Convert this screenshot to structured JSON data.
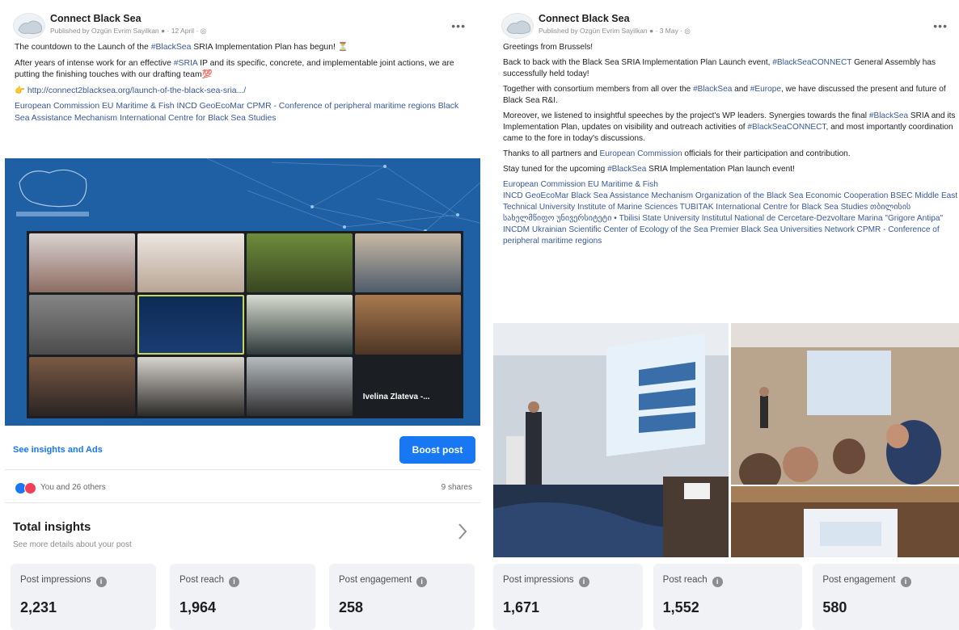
{
  "left_post": {
    "page_name": "Connect Black Sea",
    "byline": "Published by Ozgün Evrim Sayilkan ● · 12 April · ◎",
    "text": {
      "p1_a": "The countdown to the Launch of the ",
      "p1_tag": "#BlackSea",
      "p1_b": " SRIA Implementation Plan has begun! ⏳",
      "p2_a": "After years of intense work for an effective ",
      "p2_tag": "#SRIA",
      "p2_b": " IP and its specific, concrete, and implementable joint actions, we are putting the finishing touches with our drafting team💯",
      "link": "👉 http://connect2blacksea.org/launch-of-the-black-sea-sria.../",
      "tags": "European Commission  EU Maritime & Fish INCD GeoEcoMar CPMR - Conference of peripheral maritime regions Black Sea Assistance Mechanism International Centre for Black Sea Studies"
    },
    "zoom_name": "Ivelina Zlateva -...",
    "see_insights": "See insights and Ads",
    "boost_label": "Boost post",
    "reactions_text": "You and 26 others",
    "shares_text": "9 shares",
    "total_insights_title": "Total insights",
    "total_insights_sub": "See more details about your post",
    "metrics": [
      {
        "label": "Post impressions",
        "value": "2,231"
      },
      {
        "label": "Post reach",
        "value": "1,964"
      },
      {
        "label": "Post engagement",
        "value": "258"
      }
    ]
  },
  "right_post": {
    "page_name": "Connect Black Sea",
    "byline": "Published by Ozgün Evrim Sayilkan ● · 3 May · ◎",
    "text": {
      "p1": "Greetings from Brussels!",
      "p2_a": "Back to back with the Black Sea SRIA Implementation Plan Launch event, ",
      "p2_tag": "#BlackSeaCONNECT",
      "p2_b": " General Assembly has successfully held today!",
      "p3_a": "Together with consortium members from all over the ",
      "p3_tag1": "#BlackSea",
      "p3_mid": " and ",
      "p3_tag2": "#Europe",
      "p3_b": ", we have discussed the present and future of Black Sea R&I.",
      "p4_a": "Moreover, we listened to insightful speeches by the project's WP leaders. Synergies towards the final ",
      "p4_tag1": "#BlackSea",
      "p4_mid": " SRIA and its Implementation Plan, updates on visibility and outreach activities of ",
      "p4_tag2": "#BlackSeaCONNECT",
      "p4_b": ", and most importantly coordination came to the fore in today's discussions.",
      "p5_a": "Thanks to all partners and ",
      "p5_tag": "European Commission",
      "p5_b": " officials for their participation and contribution.",
      "p6_a": "Stay tuned for the upcoming ",
      "p6_tag": "#BlackSea",
      "p6_b": " SRIA Implementation Plan launch event!",
      "tags_line1": "European Commission EU Maritime & Fish",
      "tags_rest": "INCD GeoEcoMar Black Sea Assistance Mechanism Organization of the Black Sea Economic Cooperation BSEC Middle East Technical University Institute of Marine Sciences TUBITAK International Centre for Black Sea Studies თბილისის სახელმწიფო უნივერსიტეტი • Tbilisi State University Institutul National de Cercetare-Dezvoltare Marina \"Grigore Antipa\" INCDM Ukrainian Scientific Center of Ecology of the Sea Premier Black Sea Universities Network CPMR - Conference of peripheral maritime regions"
    },
    "metrics": [
      {
        "label": "Post impressions",
        "value": "1,671"
      },
      {
        "label": "Post reach",
        "value": "1,552"
      },
      {
        "label": "Post engagement",
        "value": "580"
      }
    ]
  },
  "colors": {
    "accent": "#1877f2",
    "hashtag": "#385898",
    "media_blue": "#1f5fa3",
    "metric_bg": "#f0f2f5"
  },
  "icons": [
    "info-icon",
    "more-options-icon",
    "chevron-right-icon",
    "like-reaction-icon",
    "love-reaction-icon",
    "globe-icon",
    "point-right-icon"
  ]
}
